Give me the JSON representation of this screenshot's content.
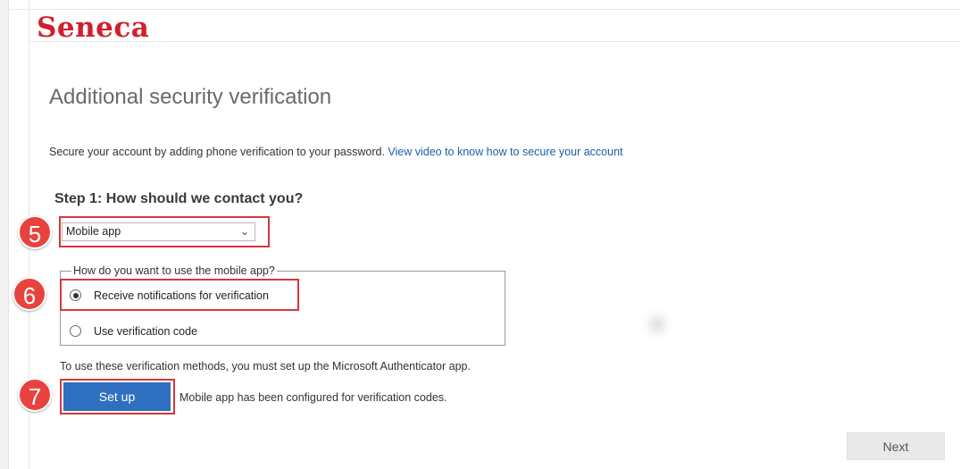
{
  "header": {
    "logo_text": "Seneca"
  },
  "page": {
    "title": "Additional security verification",
    "intro_text": "Secure your account by adding phone verification to your password. ",
    "intro_link": "View video to know how to secure your account"
  },
  "step1": {
    "title": "Step 1: How should we contact you?",
    "contact_method": {
      "selected": "Mobile app"
    },
    "mobile_app_group": {
      "legend": "How do you want to use the mobile app?",
      "options": [
        {
          "label": "Receive notifications for verification",
          "selected": true
        },
        {
          "label": "Use verification code",
          "selected": false
        }
      ]
    },
    "note": "To use these verification methods, you must set up the Microsoft Authenticator app.",
    "setup_button": "Set up",
    "status_text": "Mobile app has been configured for verification codes."
  },
  "annotations": {
    "badge_5": "5",
    "badge_6": "6",
    "badge_7": "7",
    "highlight_color": "#d9363e",
    "badge_color": "#e8423f"
  },
  "footer": {
    "next_button": "Next"
  },
  "colors": {
    "brand": "#d0202e",
    "link": "#1a5fa6",
    "primary_button": "#2f6fbf"
  }
}
